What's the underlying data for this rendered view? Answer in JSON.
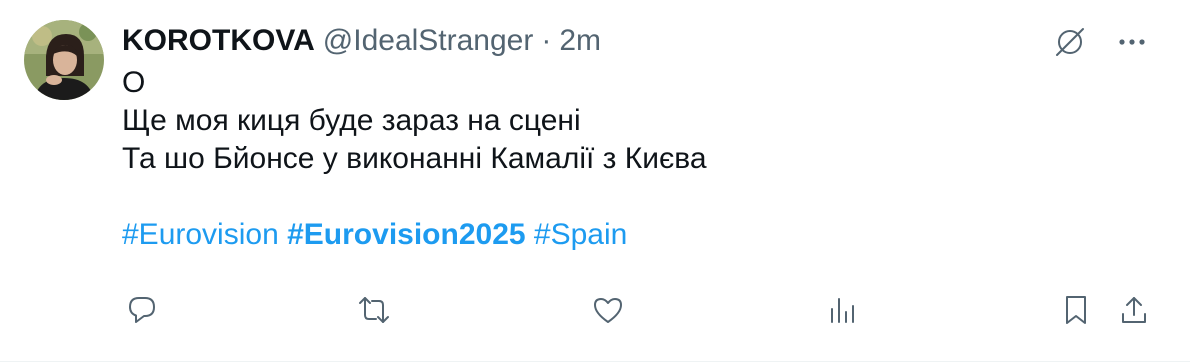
{
  "tweet": {
    "author": {
      "display_name": "KOROTKOVA",
      "handle": "@IdealStranger",
      "separator": "·",
      "time": "2m",
      "avatar": "avatar-photo"
    },
    "text_lines": [
      "О",
      "Ще моя киця буде зараз на сцені",
      "Та шо Бйонсе у виконанні Камалії з Києва"
    ],
    "hashtags": [
      {
        "text": "#Eurovision",
        "bold": false
      },
      {
        "text": "#Eurovision2025",
        "bold": true
      },
      {
        "text": "#Spain",
        "bold": false
      }
    ],
    "top_icons": [
      "grok-slash-icon",
      "more-dots-icon"
    ],
    "actions": [
      "reply-icon",
      "retweet-icon",
      "like-icon",
      "views-icon",
      "bookmark-icon",
      "share-icon"
    ]
  },
  "colors": {
    "text": "#0f1419",
    "secondary": "#536471",
    "link": "#1d9bf0",
    "background": "#ffffff"
  }
}
